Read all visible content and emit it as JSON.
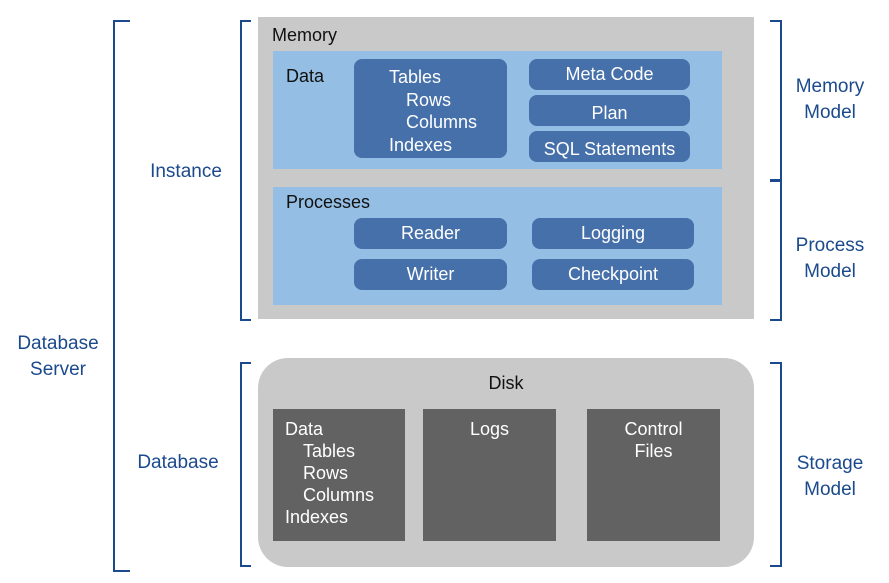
{
  "labels": {
    "database_server": [
      "Database",
      "Server"
    ],
    "instance": "Instance",
    "database": "Database",
    "memory_model": [
      "Memory",
      "Model"
    ],
    "process_model": [
      "Process",
      "Model"
    ],
    "storage_model": [
      "Storage",
      "Model"
    ]
  },
  "memory": {
    "title": "Memory",
    "data": {
      "title": "Data",
      "structures": [
        "Tables",
        "Rows",
        "Columns",
        "Indexes"
      ],
      "items": [
        "Meta Code",
        "Plan",
        "SQL Statements"
      ]
    },
    "processes": {
      "title": "Processes",
      "items": [
        "Reader",
        "Logging",
        "Writer",
        "Checkpoint"
      ]
    }
  },
  "disk": {
    "title": "Disk",
    "data": [
      "Data",
      "Tables",
      "Rows",
      "Columns",
      "Indexes"
    ],
    "logs": "Logs",
    "control": [
      "Control",
      "Files"
    ]
  },
  "colors": {
    "bracket": "#1b4a8c",
    "memory_bg": "#c9c9c9",
    "section_bg": "#94bee3",
    "pill": "#4670aa",
    "disk_box": "#626262"
  }
}
